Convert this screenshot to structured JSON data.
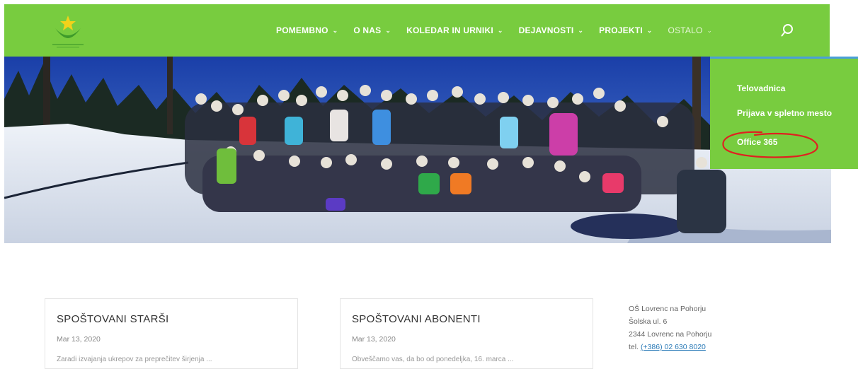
{
  "nav": {
    "items": [
      {
        "label": "POMEMBNO",
        "chevron": "chevron-down-icon"
      },
      {
        "label": "O NAS",
        "chevron": "chevron-down-icon"
      },
      {
        "label": "KOLEDAR IN URNIKI",
        "chevron": "chevron-down-icon"
      },
      {
        "label": "DEJAVNOSTI",
        "chevron": "chevron-down-icon"
      },
      {
        "label": "PROJEKTI",
        "chevron": "chevron-down-icon"
      },
      {
        "label": "OSTALO",
        "chevron": "chevron-down-icon"
      }
    ],
    "search_icon": "search-icon"
  },
  "dropdown": {
    "items": [
      {
        "label": "Telovadnica"
      },
      {
        "label": "Prijava v spletno mesto"
      },
      {
        "label": "Office 365"
      }
    ]
  },
  "posts": [
    {
      "title": "SPOŠTOVANI STARŠI",
      "date": "Mar 13, 2020",
      "excerpt": "Zaradi izvajanja ukrepov za preprečitev širjenja ..."
    },
    {
      "title": "SPOŠTOVANI ABONENTI",
      "date": "Mar 13, 2020",
      "excerpt": "Obveščamo vas, da bo od ponedeljka, 16. marca ..."
    }
  ],
  "contact": {
    "school": "OŠ Lovrenc na Pohorju",
    "street": "Šolska ul. 6",
    "city": "2344 Lovrenc na Pohorju",
    "tel_label": "tel.",
    "tel": "(+386) 02 630 8020"
  },
  "colors": {
    "header": "#78cc3f",
    "dropdown_border": "#4a9fd8",
    "annotation": "#e02020"
  }
}
